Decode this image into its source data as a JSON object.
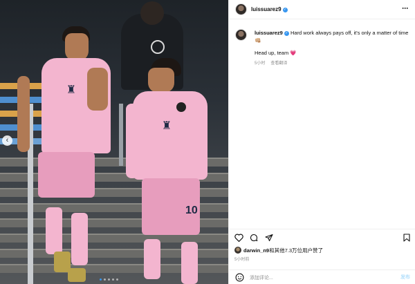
{
  "post": {
    "username": "luissuarez9",
    "verified": true,
    "caption_line1": "Hard work always pays off, it's only a matter of time",
    "caption_emoji1": "👊🏼",
    "caption_line2": "Head up, team",
    "caption_emoji2": "💗",
    "time_ago": "5小时",
    "translate_label": "查看翻译",
    "likes_user": "darwin_n9",
    "likes_text": "和其他7.3万位用户赞了",
    "posted_time": "5小时前",
    "comment_placeholder": "添加评论...",
    "post_button": "发布",
    "more_icon": "⋯"
  },
  "media": {
    "kit_color": "#f3b5cf",
    "background_color": "#2a3037",
    "jersey_number": "10",
    "carousel_count": 5,
    "carousel_active": 1
  },
  "colors": {
    "accent": "#3897f0",
    "heart": "#e64a9b"
  }
}
